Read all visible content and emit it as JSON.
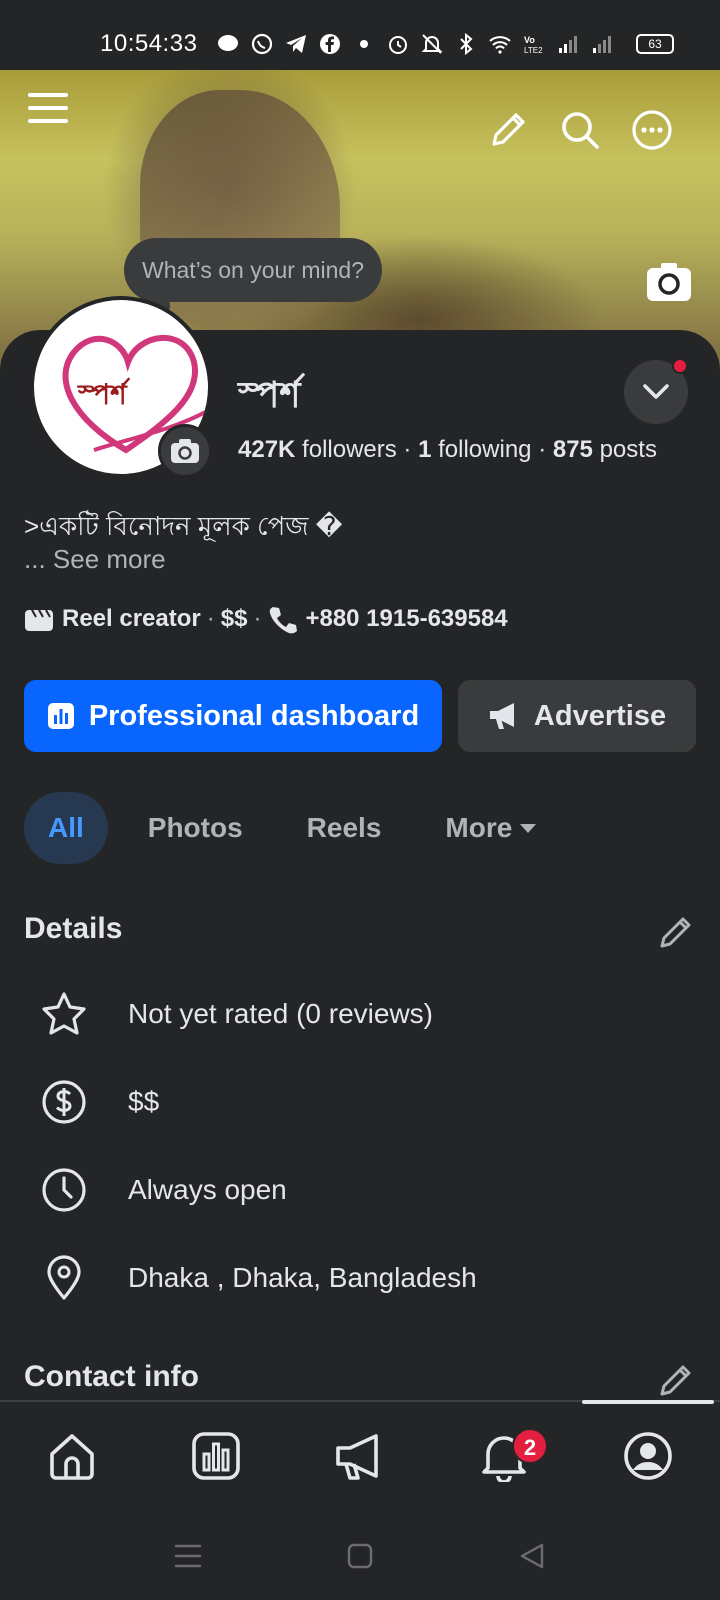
{
  "status_bar": {
    "time": "10:54:33",
    "battery": "63"
  },
  "cover": {
    "whats_on_mind": "What’s on your mind?"
  },
  "profile": {
    "name": "স্পর্শ",
    "avatar_text": "স্পর্শ",
    "followers_count": "427K",
    "followers_label": "followers",
    "following_count": "1",
    "following_label": "following",
    "posts_count": "875",
    "posts_label": "posts",
    "bio": ">একটি বিনোদন মূলক পেজ �",
    "see_more": "... See more",
    "category": "Reel creator",
    "price": "$$",
    "phone": "+880 1915-639584"
  },
  "actions": {
    "professional_dashboard": "Professional dashboard",
    "advertise": "Advertise"
  },
  "tabs": [
    {
      "label": "All",
      "active": true
    },
    {
      "label": "Photos",
      "active": false
    },
    {
      "label": "Reels",
      "active": false
    },
    {
      "label": "More",
      "active": false
    }
  ],
  "details": {
    "title": "Details",
    "rating": "Not yet rated (0 reviews)",
    "price": "$$",
    "hours": "Always open",
    "location": "Dhaka , Dhaka, Bangladesh"
  },
  "contact": {
    "title": "Contact info"
  },
  "bottom_nav": {
    "notification_count": "2",
    "items": [
      "home-icon",
      "insights-icon",
      "megaphone-icon",
      "bell-icon",
      "profile-icon"
    ]
  },
  "colors": {
    "background": "#242527",
    "primary_blue": "#0866ff",
    "active_tab_bg": "#263951",
    "active_tab_text": "#4599ff",
    "badge_red": "#e41e3f"
  }
}
